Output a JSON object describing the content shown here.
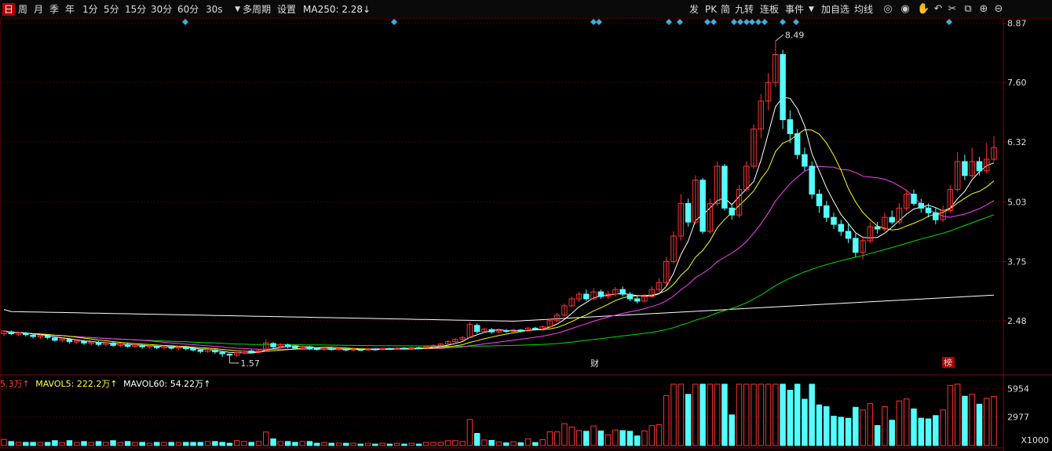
{
  "toolbar": {
    "periods": [
      "日",
      "周",
      "月",
      "季",
      "年",
      "1分",
      "5分",
      "15分",
      "30分",
      "60分"
    ],
    "active_period": "日",
    "interval_select": "30s",
    "multi_period": "多周期",
    "settings": "设置",
    "ma250_label": "MA250: 2.28",
    "ma250_arrow": "↓",
    "right_tools": [
      "发",
      "PK",
      "简",
      "九转",
      "连板",
      "事件",
      "加自选",
      "均线"
    ],
    "right_icons": [
      "target-icon",
      "eye-icon",
      "hand-icon",
      "undo-icon",
      "scissors-icon",
      "copy-icon",
      "zoom-in-icon",
      "zoom-out-icon"
    ]
  },
  "volume_legend": {
    "vol_value": "5.3万",
    "mavol5_label": "MAVOL5: 222.2万",
    "mavol60_label": "MAVOL60: 54.22万",
    "arrow": "↑"
  },
  "volume_axis": {
    "unit": "X1000",
    "ticks": [
      "5954",
      "2977"
    ]
  },
  "markers": {
    "cai": "财",
    "bang": "榜"
  },
  "annotations": {
    "high": "8.49",
    "low": "1.57"
  },
  "colors": {
    "up": "#ff3232",
    "down": "#54ffff",
    "ma5": "#ffffff",
    "ma10": "#ffff00",
    "ma20": "#ff40ff",
    "ma60": "#00e000",
    "ma250": "#ffffff",
    "grid": "#7a0000"
  },
  "chart_data": {
    "type": "candlestick",
    "price_axis_ticks": [
      8.87,
      7.6,
      6.32,
      5.03,
      3.75,
      2.48
    ],
    "price_range": [
      1.45,
      8.95
    ],
    "high_point": 8.49,
    "low_point": 1.57,
    "volume_axis_ticks": [
      5954,
      2977
    ],
    "volume_unit": "X1000",
    "series_desc": [
      "MA5",
      "MA10",
      "MA20",
      "MA60",
      "MA250"
    ],
    "candles": [
      [
        2.2,
        2.26,
        2.15,
        2.28
      ],
      [
        2.24,
        2.2,
        2.17,
        2.27
      ],
      [
        2.19,
        2.22,
        2.15,
        2.24
      ],
      [
        2.21,
        2.18,
        2.14,
        2.24
      ],
      [
        2.17,
        2.14,
        2.1,
        2.2
      ],
      [
        2.13,
        2.16,
        2.08,
        2.19
      ],
      [
        2.15,
        2.12,
        2.08,
        2.18
      ],
      [
        2.11,
        2.06,
        2.03,
        2.14
      ],
      [
        2.06,
        2.09,
        2.02,
        2.12
      ],
      [
        2.08,
        2.03,
        1.99,
        2.11
      ],
      [
        2.02,
        2.05,
        1.98,
        2.08
      ],
      [
        2.04,
        2.0,
        1.96,
        2.07
      ],
      [
        1.99,
        2.02,
        1.95,
        2.04
      ],
      [
        2.01,
        1.97,
        1.93,
        2.04
      ],
      [
        1.97,
        2.0,
        1.93,
        2.02
      ],
      [
        2.0,
        1.95,
        1.92,
        2.03
      ],
      [
        1.95,
        1.98,
        1.91,
        2.0
      ],
      [
        1.97,
        1.93,
        1.9,
        2.0
      ],
      [
        1.93,
        1.96,
        1.9,
        1.99
      ],
      [
        1.95,
        1.92,
        1.88,
        1.98
      ],
      [
        1.92,
        1.94,
        1.88,
        1.97
      ],
      [
        1.93,
        1.9,
        1.87,
        1.96
      ],
      [
        1.9,
        1.93,
        1.86,
        1.95
      ],
      [
        1.92,
        1.89,
        1.86,
        1.95
      ],
      [
        1.89,
        1.92,
        1.85,
        1.94
      ],
      [
        1.91,
        1.88,
        1.84,
        1.94
      ],
      [
        1.88,
        1.85,
        1.82,
        1.9
      ],
      [
        1.85,
        1.82,
        1.78,
        1.87
      ],
      [
        1.82,
        1.86,
        1.79,
        1.88
      ],
      [
        1.85,
        1.81,
        1.77,
        1.87
      ],
      [
        1.8,
        1.77,
        1.7,
        1.82
      ],
      [
        1.76,
        1.74,
        1.57,
        1.78
      ],
      [
        1.74,
        1.79,
        1.7,
        1.8
      ],
      [
        1.79,
        1.83,
        1.76,
        1.85
      ],
      [
        1.83,
        1.8,
        1.78,
        1.86
      ],
      [
        1.8,
        1.84,
        1.78,
        1.87
      ],
      [
        1.85,
        2.0,
        1.83,
        2.08
      ],
      [
        1.99,
        1.92,
        1.88,
        2.02
      ],
      [
        1.93,
        1.97,
        1.9,
        1.99
      ],
      [
        1.96,
        1.92,
        1.89,
        1.99
      ],
      [
        1.92,
        1.89,
        1.86,
        1.95
      ],
      [
        1.89,
        1.93,
        1.86,
        1.95
      ],
      [
        1.92,
        1.88,
        1.85,
        1.94
      ],
      [
        1.88,
        1.86,
        1.84,
        1.91
      ],
      [
        1.86,
        1.89,
        1.84,
        1.91
      ],
      [
        1.88,
        1.86,
        1.84,
        1.9
      ],
      [
        1.86,
        1.88,
        1.84,
        1.9
      ],
      [
        1.87,
        1.85,
        1.83,
        1.89
      ],
      [
        1.85,
        1.87,
        1.83,
        1.89
      ],
      [
        1.86,
        1.85,
        1.83,
        1.88
      ],
      [
        1.85,
        1.87,
        1.84,
        1.89
      ],
      [
        1.87,
        1.86,
        1.84,
        1.89
      ],
      [
        1.86,
        1.88,
        1.85,
        1.9
      ],
      [
        1.88,
        1.87,
        1.85,
        1.9
      ],
      [
        1.87,
        1.89,
        1.86,
        1.91
      ],
      [
        1.89,
        1.88,
        1.86,
        1.91
      ],
      [
        1.88,
        1.9,
        1.87,
        1.92
      ],
      [
        1.9,
        1.89,
        1.87,
        1.92
      ],
      [
        1.89,
        1.92,
        1.88,
        1.94
      ],
      [
        1.92,
        1.95,
        1.9,
        1.97
      ],
      [
        1.95,
        1.98,
        1.93,
        2.0
      ],
      [
        1.98,
        2.03,
        1.96,
        2.06
      ],
      [
        2.03,
        2.08,
        2.01,
        2.11
      ],
      [
        2.08,
        2.12,
        2.05,
        2.15
      ],
      [
        2.12,
        2.4,
        2.1,
        2.45
      ],
      [
        2.38,
        2.25,
        2.2,
        2.42
      ],
      [
        2.25,
        2.3,
        2.22,
        2.33
      ],
      [
        2.29,
        2.24,
        2.2,
        2.32
      ],
      [
        2.24,
        2.27,
        2.21,
        2.3
      ],
      [
        2.27,
        2.25,
        2.22,
        2.3
      ],
      [
        2.25,
        2.28,
        2.23,
        2.31
      ],
      [
        2.28,
        2.26,
        2.23,
        2.3
      ],
      [
        2.26,
        2.32,
        2.24,
        2.35
      ],
      [
        2.32,
        2.3,
        2.27,
        2.35
      ],
      [
        2.3,
        2.35,
        2.28,
        2.38
      ],
      [
        2.35,
        2.48,
        2.33,
        2.52
      ],
      [
        2.48,
        2.6,
        2.45,
        2.65
      ],
      [
        2.6,
        2.8,
        2.57,
        2.85
      ],
      [
        2.8,
        2.95,
        2.76,
        3.0
      ],
      [
        2.95,
        3.05,
        2.88,
        3.1
      ],
      [
        3.05,
        2.95,
        2.9,
        3.15
      ],
      [
        2.95,
        3.1,
        2.92,
        3.18
      ],
      [
        3.1,
        3.0,
        2.95,
        3.15
      ],
      [
        3.0,
        3.05,
        2.95,
        3.12
      ],
      [
        3.05,
        3.15,
        3.0,
        3.2
      ],
      [
        3.15,
        3.05,
        3.0,
        3.22
      ],
      [
        3.05,
        2.95,
        2.9,
        3.1
      ],
      [
        2.95,
        2.9,
        2.85,
        3.0
      ],
      [
        2.9,
        3.0,
        2.87,
        3.05
      ],
      [
        3.0,
        3.15,
        2.97,
        3.22
      ],
      [
        3.15,
        3.3,
        3.1,
        3.4
      ],
      [
        3.3,
        3.75,
        3.25,
        3.85
      ],
      [
        3.75,
        4.3,
        3.7,
        4.4
      ],
      [
        4.3,
        5.0,
        4.2,
        5.2
      ],
      [
        5.0,
        4.6,
        4.5,
        5.1
      ],
      [
        4.6,
        5.5,
        4.55,
        5.6
      ],
      [
        5.5,
        4.4,
        4.35,
        5.55
      ],
      [
        4.4,
        5.0,
        4.35,
        5.1
      ],
      [
        5.0,
        5.8,
        4.95,
        5.9
      ],
      [
        5.8,
        4.9,
        4.85,
        5.85
      ],
      [
        4.9,
        4.75,
        4.65,
        5.0
      ],
      [
        4.75,
        5.3,
        4.7,
        5.4
      ],
      [
        5.3,
        5.8,
        5.25,
        5.9
      ],
      [
        5.8,
        6.6,
        5.75,
        6.7
      ],
      [
        6.6,
        7.2,
        6.4,
        7.35
      ],
      [
        7.2,
        7.6,
        7.0,
        7.8
      ],
      [
        7.6,
        8.2,
        7.5,
        8.49
      ],
      [
        8.2,
        6.8,
        6.6,
        8.3
      ],
      [
        6.8,
        6.5,
        6.3,
        7.0
      ],
      [
        6.5,
        6.05,
        5.95,
        6.6
      ],
      [
        6.05,
        5.8,
        5.7,
        6.2
      ],
      [
        5.8,
        5.2,
        5.1,
        5.9
      ],
      [
        5.2,
        4.95,
        4.8,
        5.3
      ],
      [
        4.95,
        4.7,
        4.6,
        5.05
      ],
      [
        4.7,
        4.55,
        4.45,
        4.8
      ],
      [
        4.55,
        4.4,
        4.3,
        4.65
      ],
      [
        4.4,
        4.25,
        4.15,
        4.55
      ],
      [
        4.25,
        3.95,
        3.85,
        4.35
      ],
      [
        3.95,
        4.2,
        3.8,
        4.3
      ],
      [
        4.2,
        4.5,
        4.15,
        4.6
      ],
      [
        4.5,
        4.45,
        4.35,
        4.6
      ],
      [
        4.45,
        4.7,
        4.4,
        4.8
      ],
      [
        4.7,
        4.6,
        4.55,
        4.85
      ],
      [
        4.6,
        4.9,
        4.55,
        5.0
      ],
      [
        4.9,
        5.2,
        4.85,
        5.3
      ],
      [
        5.2,
        5.0,
        4.95,
        5.3
      ],
      [
        5.0,
        4.9,
        4.8,
        5.1
      ],
      [
        4.9,
        4.8,
        4.7,
        5.0
      ],
      [
        4.8,
        4.65,
        4.55,
        4.9
      ],
      [
        4.65,
        4.85,
        4.6,
        4.95
      ],
      [
        4.85,
        5.3,
        4.8,
        5.4
      ],
      [
        5.3,
        5.9,
        5.25,
        6.1
      ],
      [
        5.9,
        5.6,
        5.5,
        6.05
      ],
      [
        5.6,
        5.9,
        5.55,
        6.2
      ],
      [
        5.9,
        5.7,
        5.6,
        6.0
      ],
      [
        5.7,
        5.95,
        5.65,
        6.3
      ],
      [
        5.95,
        6.2,
        5.9,
        6.45
      ]
    ]
  }
}
